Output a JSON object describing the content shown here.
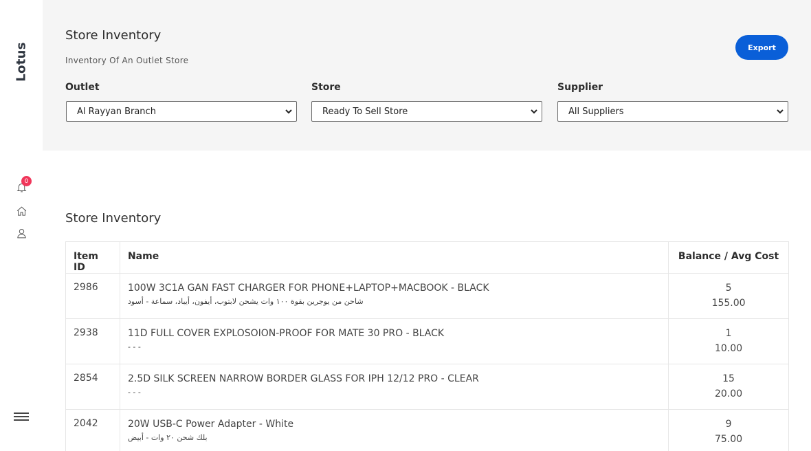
{
  "sidebar": {
    "brand": "Lotus",
    "notification_count": "0"
  },
  "header": {
    "title": "Store Inventory",
    "subtitle": "Inventory Of An Outlet Store",
    "export_label": "Export"
  },
  "filters": {
    "outlet": {
      "label": "Outlet",
      "value": "Al Rayyan Branch"
    },
    "store": {
      "label": "Store",
      "value": "Ready To Sell Store"
    },
    "supplier": {
      "label": "Supplier",
      "value": "All Suppliers"
    }
  },
  "table": {
    "title": "Store Inventory",
    "headers": {
      "id": "Item ID",
      "name": "Name",
      "balance": "Balance / Avg Cost"
    },
    "rows": [
      {
        "id": "2986",
        "name": "100W 3C1A GAN FAST CHARGER FOR PHONE+LAPTOP+MACBOOK - BLACK",
        "sub": "شاحن من يوجرين بقوة ١٠٠ وات يشحن لابتوب، أيفون، أيباد، سماعة - أسود",
        "balance": "5",
        "cost": "155.00"
      },
      {
        "id": "2938",
        "name": "11D FULL COVER EXPLOSOION-PROOF FOR MATE 30 PRO - BLACK",
        "sub": "- - -",
        "balance": "1",
        "cost": "10.00"
      },
      {
        "id": "2854",
        "name": "2.5D SILK SCREEN NARROW BORDER GLASS FOR IPH 12/12 PRO - CLEAR",
        "sub": "- - -",
        "balance": "15",
        "cost": "20.00"
      },
      {
        "id": "2042",
        "name": "20W USB-C Power Adapter - White",
        "sub": "بلك شحن ٢٠ وات - أبيض",
        "balance": "9",
        "cost": "75.00"
      }
    ]
  }
}
